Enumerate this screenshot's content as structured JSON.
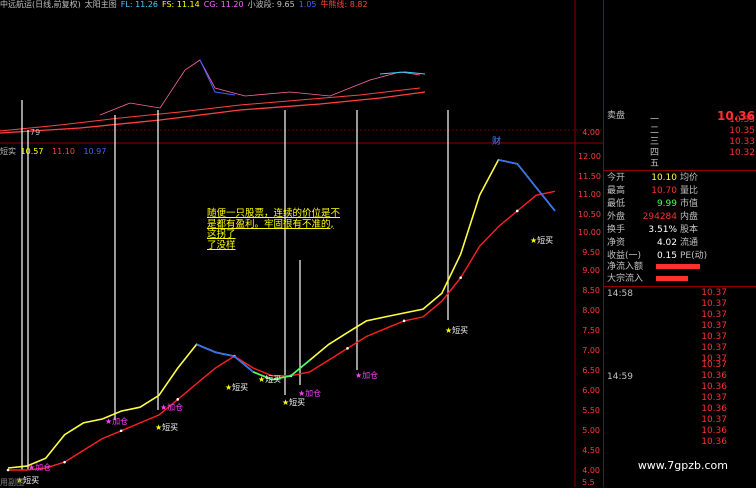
{
  "title_bar": {
    "stock": "中远航运(日线,前复权)",
    "indicator": "太阳主图",
    "fl": "FL: 11.26",
    "fs": "FS: 11.14",
    "cg": "CG: 11.20",
    "wave": "小波段: 9.65",
    "wave2": "1.05",
    "niu": "牛熊线: 8.82"
  },
  "sub_bar": {
    "label": "短实",
    "v1": "10.57",
    "v2": "11.10",
    "v3": "10.97"
  },
  "fin_mark": "财",
  "buy_label": "短买",
  "add_label": "加仓",
  "left_edge_price": "79",
  "note": {
    "line1": "随便一只股票，连续的价位是不",
    "line2": "是都有盈利。牢固很有不准的,",
    "line3": "这拐了",
    "line4": "了没样"
  },
  "axis": {
    "ticks": [
      "4.00",
      "12.00",
      "11.50",
      "11.00",
      "10.50",
      "10.00",
      "9.50",
      "9.00",
      "8.50",
      "8.00",
      "7.50",
      "7.00",
      "6.50",
      "6.00",
      "5.50",
      "5.00",
      "4.50",
      "4.00"
    ],
    "bottom_partial": "5.5"
  },
  "bottom_left": "用副图",
  "quote": {
    "sell_label": "卖盘",
    "sell_price": "10.36",
    "sell_levels": [
      "一",
      "二",
      "三",
      "四",
      "五"
    ],
    "sell_prices": [
      "10.35",
      "10.35",
      "10.33",
      "10.32"
    ],
    "stats": [
      {
        "l": "今开",
        "v": "10.10",
        "l2": "均价",
        "v2": ""
      },
      {
        "l": "最高",
        "v": "10.70",
        "l2": "量比",
        "v2": ""
      },
      {
        "l": "最低",
        "v": "9.99",
        "l2": "市值",
        "v2": ""
      },
      {
        "l": "外盘",
        "v": "294284",
        "l2": "内盘",
        "v2": ""
      },
      {
        "l": "换手",
        "v": "3.51%",
        "l2": "股本",
        "v2": ""
      },
      {
        "l": "净资",
        "v": "4.02",
        "l2": "流通",
        "v2": ""
      },
      {
        "l": "收益(一)",
        "v": "0.15",
        "l2": "PE(动)",
        "v2": ""
      }
    ],
    "flow1": "净流入额",
    "flow2": "大宗流入",
    "time1": "14:58",
    "time2": "14:59",
    "ticks1": [
      "10.37",
      "10.37",
      "10.37",
      "10.37",
      "10.37",
      "10.37",
      "10.37"
    ],
    "ticks2": [
      "10.37",
      "10.36",
      "10.36",
      "10.37",
      "10.36",
      "10.37",
      "10.36",
      "10.36"
    ]
  },
  "watermark": "www.7gpzb.com",
  "chart_data": {
    "type": "line",
    "title": "",
    "ylim": [
      4.0,
      12.0
    ],
    "series": [
      {
        "name": "",
        "values": [
          4.05,
          4.1,
          4.3,
          4.9,
          5.2,
          5.3,
          5.5,
          5.6,
          5.9,
          6.6,
          7.2,
          7.0,
          6.9,
          6.5,
          6.3,
          6.4,
          6.8,
          7.2,
          7.5,
          7.8,
          7.9,
          8.0,
          8.1,
          8.5,
          9.5,
          11.0,
          11.9,
          11.8,
          11.2,
          10.6
        ]
      },
      {
        "name": "",
        "values": [
          4.0,
          4.0,
          4.05,
          4.2,
          4.5,
          4.8,
          5.0,
          5.2,
          5.4,
          5.8,
          6.2,
          6.6,
          6.9,
          6.6,
          6.4,
          6.4,
          6.5,
          6.8,
          7.1,
          7.4,
          7.6,
          7.8,
          7.9,
          8.3,
          8.9,
          9.7,
          10.2,
          10.6,
          11.0,
          11.1
        ]
      }
    ]
  }
}
